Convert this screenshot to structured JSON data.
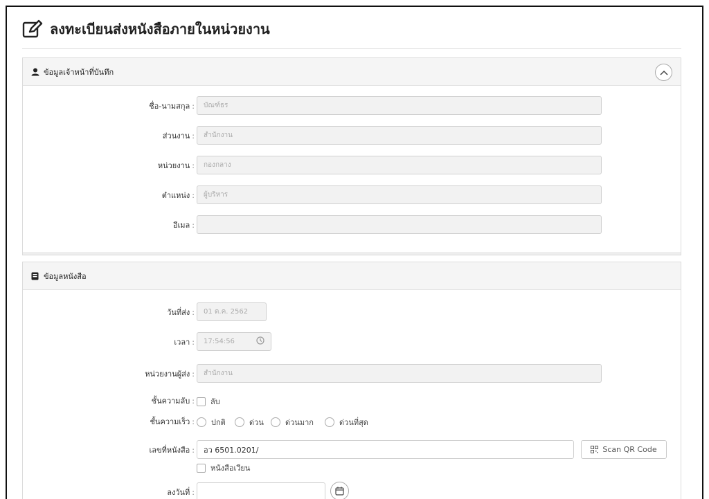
{
  "page": {
    "title": "ลงทะเบียนส่งหนังสือภายในหน่วยงาน"
  },
  "officer_section": {
    "heading": "ข้อมูลเจ้าหน้าที่บันทึก",
    "fields": [
      {
        "label": "ชื่อ-นามสกุล",
        "value": "บัณฑ์ธร"
      },
      {
        "label": "ส่วนงาน",
        "value": "สำนักงาน"
      },
      {
        "label": "หน่วยงาน",
        "value": "กองกลาง"
      },
      {
        "label": "ตำแหน่ง",
        "value": "ผู้บริหาร"
      },
      {
        "label": "อีเมล",
        "value": ""
      }
    ]
  },
  "document_section": {
    "heading": "ข้อมูลหนังสือ",
    "send_date": {
      "label": "วันที่ส่ง",
      "value": "01 ต.ค. 2562"
    },
    "time": {
      "label": "เวลา",
      "value": "17:54:56"
    },
    "sender_unit": {
      "label": "หน่วยงานผู้ส่ง",
      "value": "สำนักงาน"
    },
    "confidentiality": {
      "label": "ชั้นความลับ",
      "option": "ลับ"
    },
    "urgency": {
      "label": "ชั้นความเร็ว",
      "options": [
        "ปกติ",
        "ด่วน",
        "ด่วนมาก",
        "ด่วนที่สุด"
      ]
    },
    "doc_number": {
      "label": "เลขที่หนังสือ",
      "value": "อว 6501.0201/",
      "circular_label": "หนังสือเวียน",
      "scan_button": "Scan QR Code"
    },
    "dated": {
      "label": "ลงวันที่",
      "value": ""
    }
  },
  "colon": ":"
}
